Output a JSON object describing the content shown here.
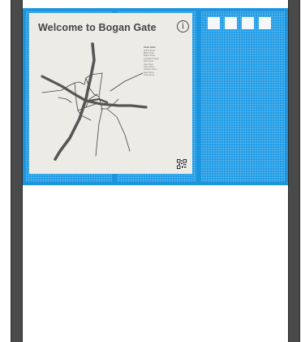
{
  "sign": {
    "title": "Welcome to Bogan Gate",
    "info_symbol": "i",
    "legend_title": "Street Index",
    "legend_items": [
      "Abbott Street",
      "Blake Street",
      "Bogan Street",
      "Condobolin Road",
      "Dahl Street",
      "Gray Street",
      "Hume Street",
      "Hamilton Street",
      "Isaac Street",
      "Gooloogong"
    ]
  }
}
